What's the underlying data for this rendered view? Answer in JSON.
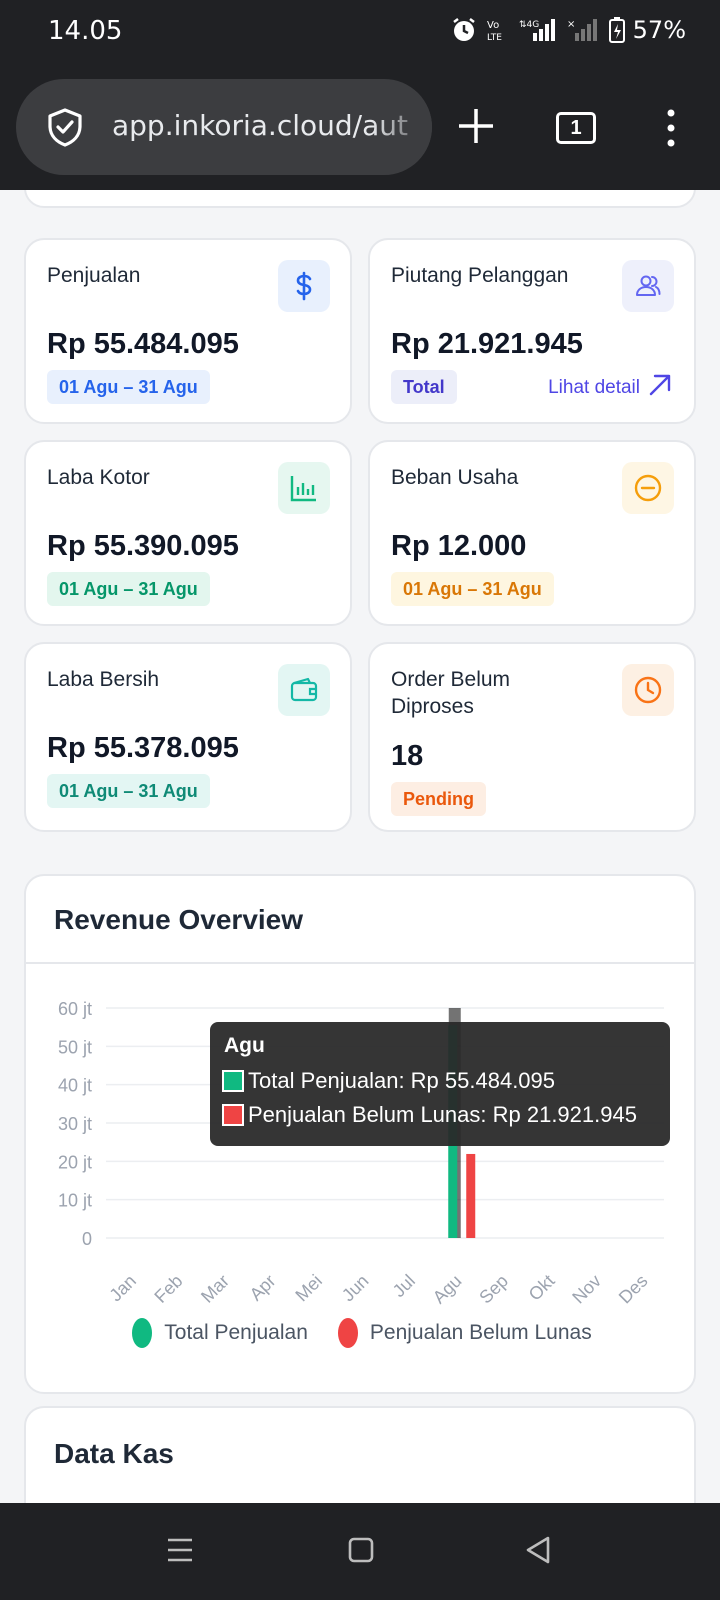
{
  "status_bar": {
    "time": "14.05",
    "battery": "57%",
    "network": "4G"
  },
  "browser": {
    "url": "app.inkoria.cloud/aut",
    "tab_count": "1"
  },
  "stats": [
    {
      "label": "Penjualan",
      "value": "Rp 55.484.095",
      "badge": "01 Agu – 31 Agu",
      "icon": "dollar-icon"
    },
    {
      "label": "Piutang Pelanggan",
      "value": "Rp 21.921.945",
      "badge": "Total",
      "link": "Lihat detail",
      "icon": "users-icon"
    },
    {
      "label": "Laba Kotor",
      "value": "Rp 55.390.095",
      "badge": "01 Agu – 31 Agu",
      "icon": "bar-chart-icon"
    },
    {
      "label": "Beban Usaha",
      "value": "Rp 12.000",
      "badge": "01 Agu – 31 Agu",
      "icon": "minus-circle-icon"
    },
    {
      "label": "Laba Bersih",
      "value": "Rp 55.378.095",
      "badge": "01 Agu – 31 Agu",
      "icon": "wallet-icon"
    },
    {
      "label": "Order Belum Diproses",
      "value": "18",
      "badge": "Pending",
      "icon": "clock-icon"
    }
  ],
  "revenue": {
    "title": "Revenue Overview",
    "tooltip": {
      "title": "Agu",
      "rows": [
        "Total Penjualan: Rp 55.484.095",
        "Penjualan Belum Lunas: Rp 21.921.945"
      ]
    }
  },
  "chart_data": {
    "type": "bar",
    "title": "Revenue Overview",
    "categories": [
      "Jan",
      "Feb",
      "Mar",
      "Apr",
      "Mei",
      "Jun",
      "Jul",
      "Agu",
      "Sep",
      "Okt",
      "Nov",
      "Des"
    ],
    "y_ticks": [
      "0",
      "10 jt",
      "20 jt",
      "30 jt",
      "40 jt",
      "50 jt",
      "60 jt"
    ],
    "ylim": [
      0,
      60000000
    ],
    "grid": true,
    "legend_position": "bottom",
    "highlighted_category": "Agu",
    "series": [
      {
        "name": "Total Penjualan",
        "color": "#10b981",
        "values": [
          0,
          0,
          0,
          0,
          0,
          0,
          0,
          55484095,
          0,
          0,
          0,
          0
        ]
      },
      {
        "name": "Penjualan Belum Lunas",
        "color": "#ef4444",
        "values": [
          0,
          0,
          0,
          0,
          0,
          0,
          0,
          21921945,
          0,
          0,
          0,
          0
        ]
      }
    ]
  },
  "kas": {
    "title": "Data Kas"
  }
}
